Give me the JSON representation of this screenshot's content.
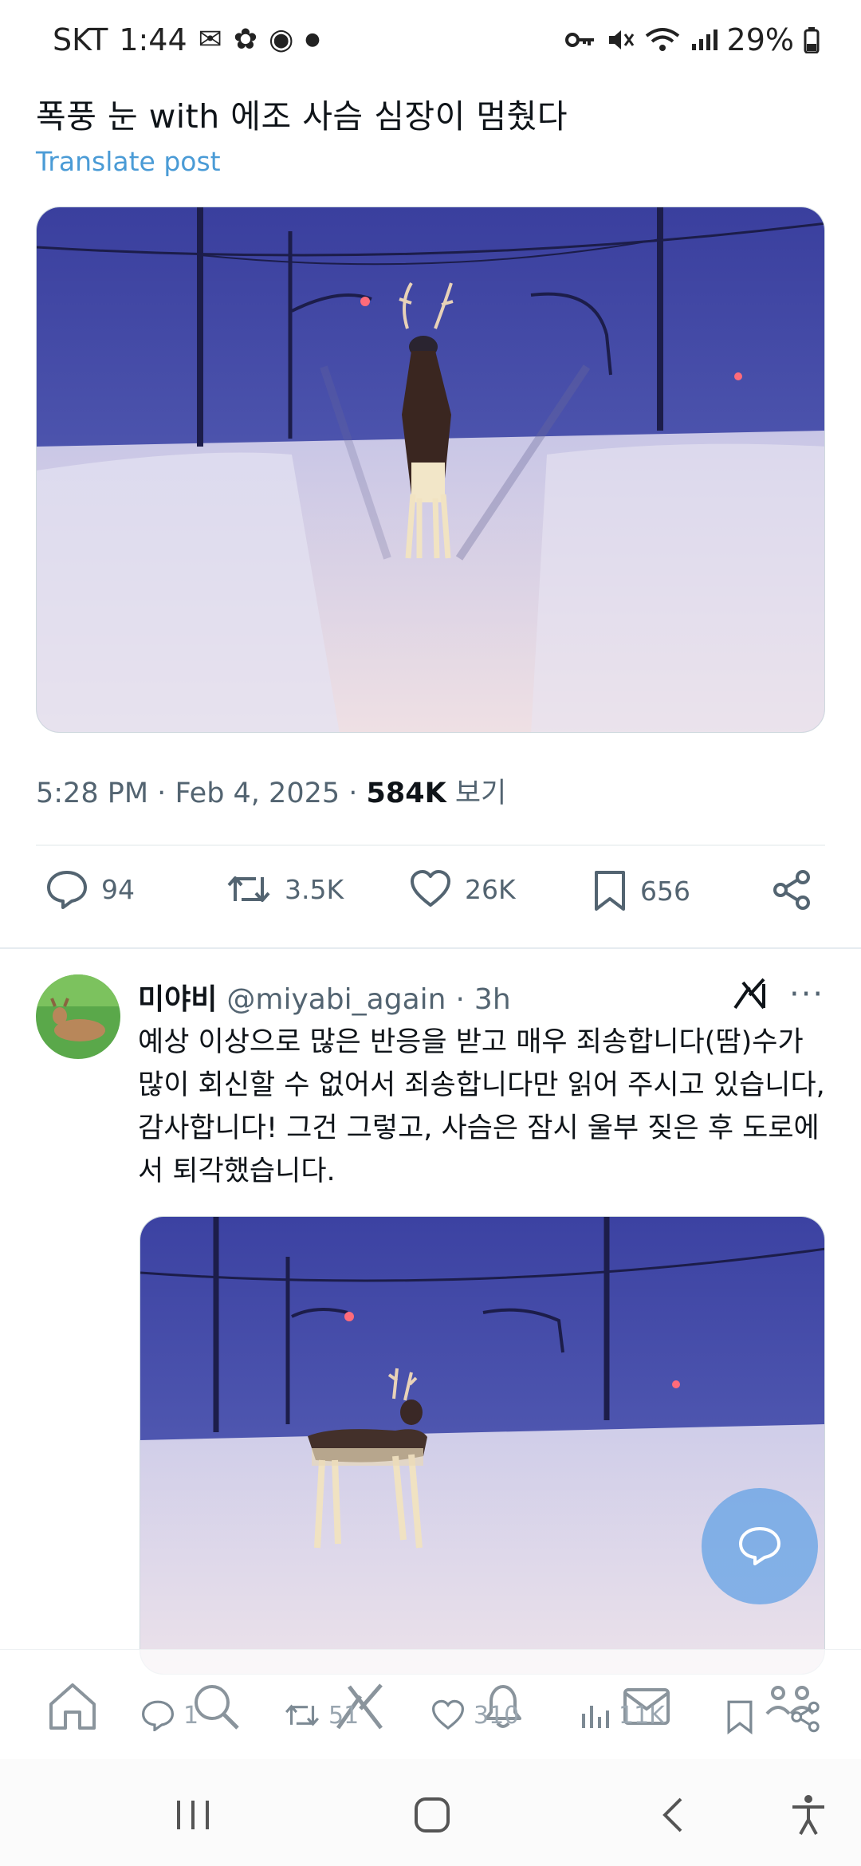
{
  "status_bar": {
    "carrier": "SKT",
    "time": "1:44",
    "battery": "29%"
  },
  "tweet": {
    "text": "폭풍 눈 with 에조 사슴 심장이 멈췄다",
    "translate_label": "Translate post",
    "time": "5:28 PM",
    "date": "Feb 4, 2025",
    "views": "584K",
    "views_label": "보기",
    "replies": "94",
    "retweets": "3.5K",
    "likes": "26K",
    "bookmarks": "656"
  },
  "reply": {
    "display_name": "미야비",
    "handle": "@miyabi_again",
    "age": "3h",
    "text": "예상 이상으로 많은 반응을 받고 매우 죄송합니다(땀)수가 많이 회신할 수 없어서 죄송합니다만 읽어 주시고 있습니다, 감사합니다! 그건 그렇고, 사슴은 잠시 울부 짖은 후 도로에서 퇴각했습니다.",
    "replies": "1",
    "retweets": "51",
    "likes": "310",
    "views": "11K"
  },
  "colors": {
    "accent": "#1d9bf0",
    "translate": "#4a9bd6",
    "muted": "#536471",
    "fab": "#68a4e6"
  },
  "icons": [
    "reply-icon",
    "retweet-icon",
    "like-icon",
    "bookmark-icon",
    "share-icon",
    "home-icon",
    "search-icon",
    "grok-icon",
    "notifications-icon",
    "messages-icon",
    "communities-icon",
    "analytics-icon"
  ]
}
